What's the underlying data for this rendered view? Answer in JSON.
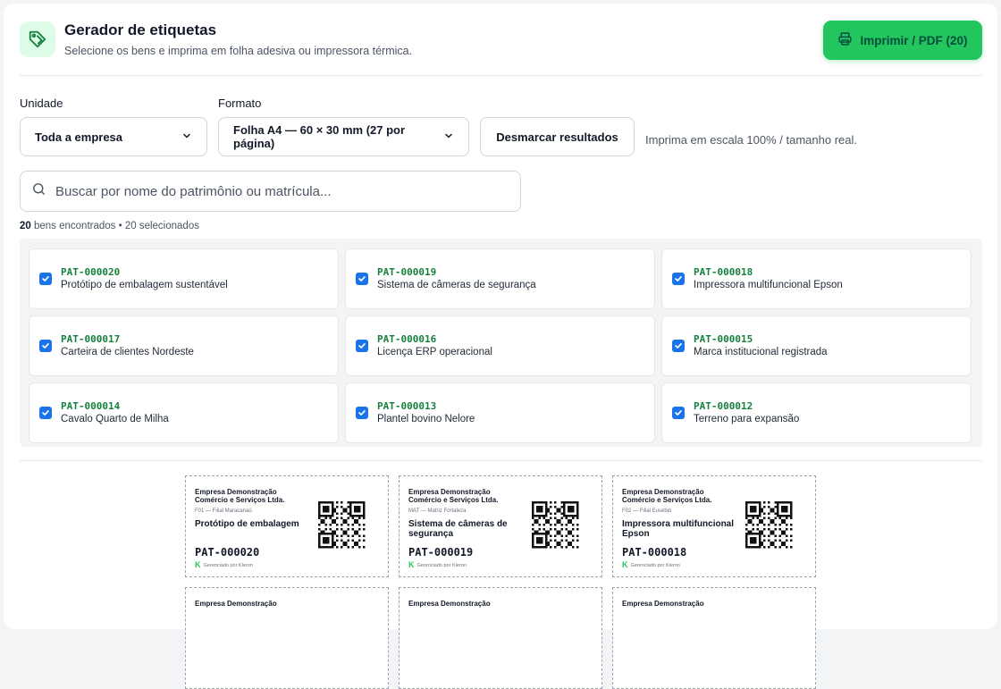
{
  "header": {
    "title": "Gerador de etiquetas",
    "subtitle": "Selecione os bens e imprima em folha adesiva ou impressora térmica.",
    "print_button": "Imprimir / PDF (20)"
  },
  "filters": {
    "unit_label": "Unidade",
    "unit_value": "Toda a empresa",
    "format_label": "Formato",
    "format_value": "Folha A4 — 60 × 30 mm (27 por página)",
    "deselect_button": "Desmarcar resultados",
    "hint": "Imprima em escala 100% / tamanho real."
  },
  "search": {
    "placeholder": "Buscar por nome do patrimônio ou matrícula..."
  },
  "counts": {
    "found_number": "20",
    "found_label": " bens encontrados",
    "separator": " • ",
    "selected": "20 selecionados"
  },
  "items": [
    {
      "code": "PAT-000020",
      "name": "Protótipo de embalagem sustentável",
      "checked": true
    },
    {
      "code": "PAT-000019",
      "name": "Sistema de câmeras de segurança",
      "checked": true
    },
    {
      "code": "PAT-000018",
      "name": "Impressora multifuncional Epson",
      "checked": true
    },
    {
      "code": "PAT-000017",
      "name": "Carteira de clientes Nordeste",
      "checked": true
    },
    {
      "code": "PAT-000016",
      "name": "Licença ERP operacional",
      "checked": true
    },
    {
      "code": "PAT-000015",
      "name": "Marca institucional registrada",
      "checked": true
    },
    {
      "code": "PAT-000014",
      "name": "Cavalo Quarto de Milha",
      "checked": true
    },
    {
      "code": "PAT-000013",
      "name": "Plantel bovino Nelore",
      "checked": true
    },
    {
      "code": "PAT-000012",
      "name": "Terreno para expansão",
      "checked": true
    }
  ],
  "labels": [
    {
      "company": "Empresa Demonstração Comércio e Serviços Ltda.",
      "branch": "F01 — Filial Maracanaú",
      "name": "Protótipo de embalagem",
      "code": "PAT-000020",
      "brand": "Gerenciado por Kleron"
    },
    {
      "company": "Empresa Demonstração Comércio e Serviços Ltda.",
      "branch": "MAT — Matriz Fortaleza",
      "name": "Sistema de câmeras de segurança",
      "code": "PAT-000019",
      "brand": "Gerenciado por Kleron"
    },
    {
      "company": "Empresa Demonstração Comércio e Serviços Ltda.",
      "branch": "F02 — Filial Eusébio",
      "name": "Impressora multifuncional Epson",
      "code": "PAT-000018",
      "brand": "Gerenciado por Kleron"
    },
    {
      "company": "Empresa Demonstração",
      "branch": "",
      "name": "",
      "code": "",
      "brand": ""
    },
    {
      "company": "Empresa Demonstração",
      "branch": "",
      "name": "",
      "code": "",
      "brand": ""
    },
    {
      "company": "Empresa Demonstração",
      "branch": "",
      "name": "",
      "code": "",
      "brand": ""
    }
  ],
  "colors": {
    "accent": "#22c55e",
    "code_green": "#15803d",
    "checkbox": "#1a73e8"
  },
  "icons": {
    "header": "tag-icon",
    "print": "printer-icon",
    "search": "search-icon",
    "select": "chevron-down-icon",
    "checkbox": "check-icon",
    "label_qr": "qr-code-icon",
    "brand": "kleron-logo-icon"
  }
}
